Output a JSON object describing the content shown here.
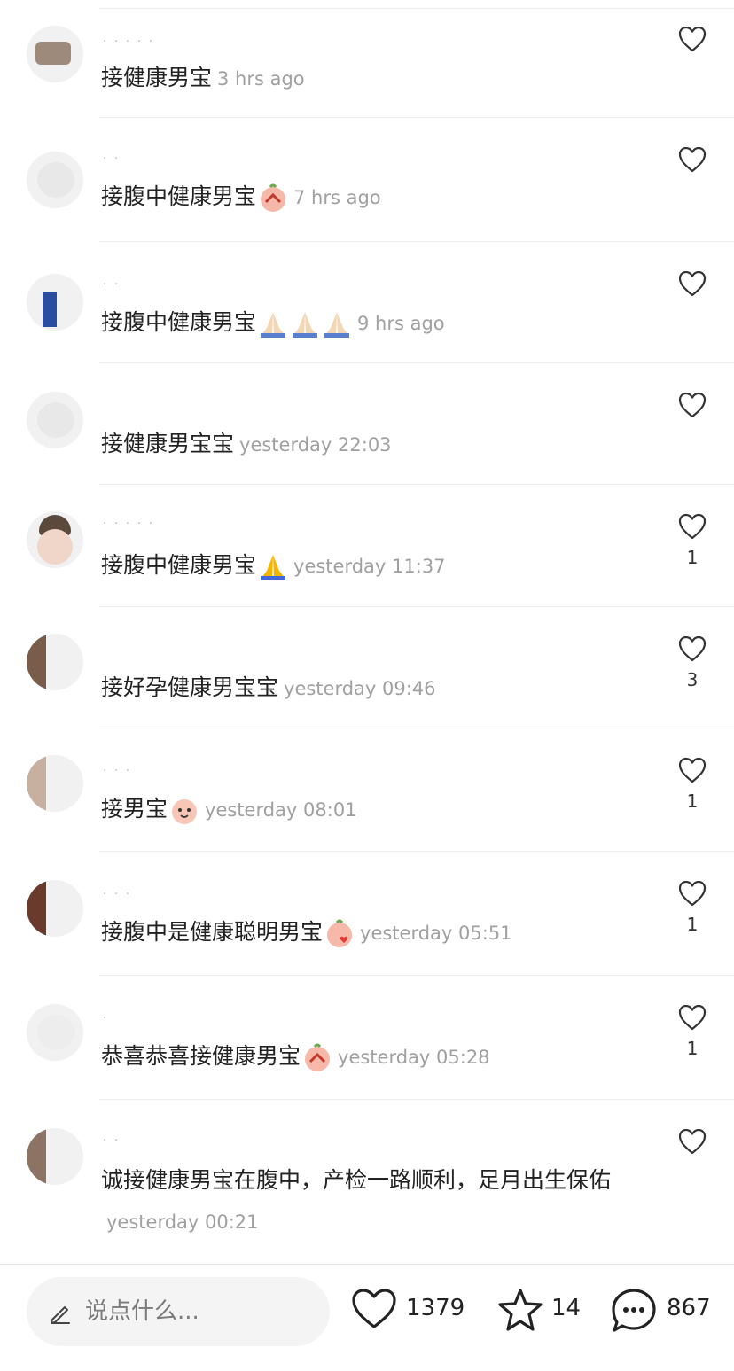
{
  "comments": [
    {
      "text": "接健康男宝",
      "emojis": [],
      "time": "3 hrs ago",
      "likes": ""
    },
    {
      "text": "接腹中健康男宝",
      "emojis": [
        "pray-emoji"
      ],
      "time": "7 hrs ago",
      "likes": ""
    },
    {
      "text": "接腹中健康男宝",
      "emojis": [
        "folded-hands-light",
        "folded-hands-light",
        "folded-hands-light"
      ],
      "time": "9 hrs ago",
      "likes": ""
    },
    {
      "text": "接健康男宝宝",
      "emojis": [],
      "time": "yesterday 22:03",
      "likes": ""
    },
    {
      "text": "接腹中健康男宝",
      "emojis": [
        "folded-hands"
      ],
      "time": "yesterday 11:37",
      "likes": "1"
    },
    {
      "text": "接好孕健康男宝宝",
      "emojis": [],
      "time": "yesterday 09:46",
      "likes": "3"
    },
    {
      "text": "接男宝",
      "emojis": [
        "smile-face"
      ],
      "time": "yesterday 08:01",
      "likes": "1"
    },
    {
      "text": "接腹中是健康聪明男宝",
      "emojis": [
        "kiss-emoji"
      ],
      "time": "yesterday 05:51",
      "likes": "1"
    },
    {
      "text": "恭喜恭喜接健康男宝",
      "emojis": [
        "pray-emoji"
      ],
      "time": "yesterday 05:28",
      "likes": "1"
    },
    {
      "text": "诚接健康男宝在腹中，产检一路顺利，足月出生保佑",
      "emojis": [],
      "time": "yesterday 00:21",
      "likes": ""
    }
  ],
  "bottom_bar": {
    "input_placeholder": "说点什么...",
    "like_count": "1379",
    "star_count": "14",
    "comment_count": "867"
  },
  "colors": {
    "text": "#222222",
    "time": "#a0a0a0",
    "divider": "#ececec",
    "input_bg": "#f4f4f4"
  }
}
